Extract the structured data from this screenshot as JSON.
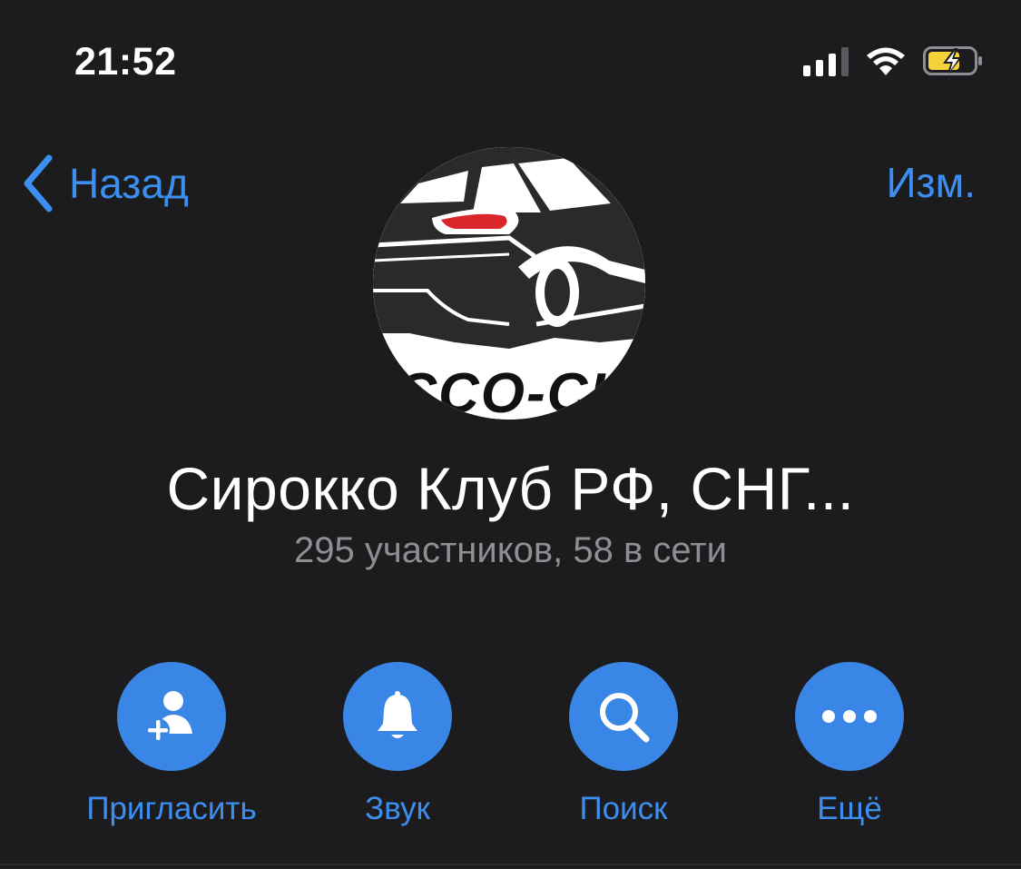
{
  "status_bar": {
    "time": "21:52",
    "icons": [
      "cellular-signal-icon",
      "wifi-icon",
      "battery-charging-icon"
    ],
    "battery_color": "#f4d23a"
  },
  "nav": {
    "back_label": "Назад",
    "edit_label": "Изм."
  },
  "group": {
    "title": "Сирокко Клуб РФ, СНГ...",
    "subtitle": "295 участников, 58 в сети",
    "avatar_text": "ROCCO-CLUB"
  },
  "actions": [
    {
      "label": "Пригласить",
      "icon": "add-user-icon"
    },
    {
      "label": "Звук",
      "icon": "bell-icon"
    },
    {
      "label": "Поиск",
      "icon": "search-icon"
    },
    {
      "label": "Ещё",
      "icon": "more-icon"
    }
  ],
  "colors": {
    "background": "#1c1c1e",
    "accent": "#3c8ff0",
    "button_fill": "#3a86e6",
    "secondary_text": "#8e8e93"
  }
}
